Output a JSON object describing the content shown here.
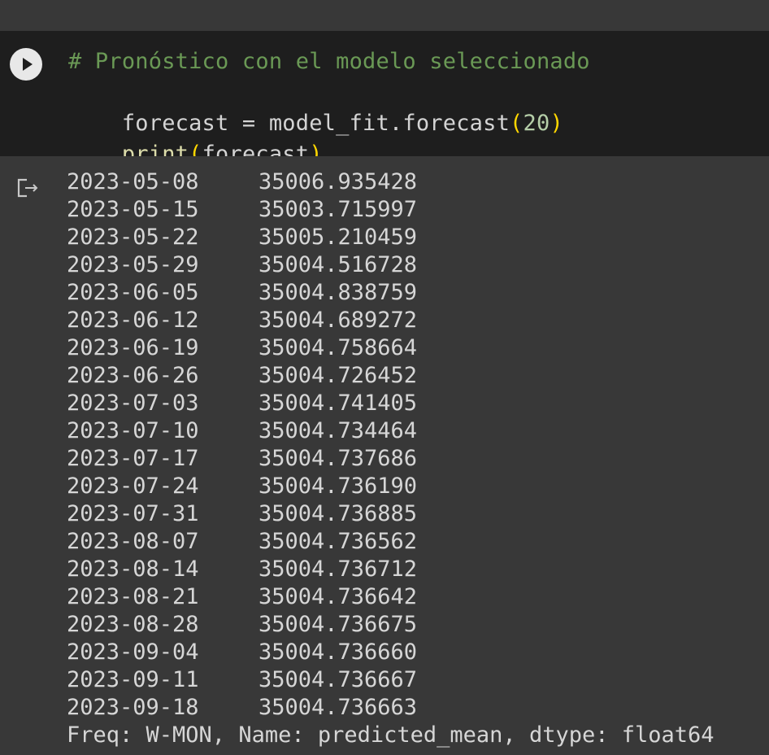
{
  "cell": {
    "comment": "# Pronóstico con el modelo seleccionado",
    "line2": {
      "lhs": "forecast = model_fit.forecast",
      "open": "(",
      "arg": "20",
      "close": ")"
    },
    "line3": {
      "func": "print",
      "open": "(",
      "arg": "forecast",
      "close": ")"
    }
  },
  "output": {
    "icon": "output-redirect-icon",
    "rows": [
      {
        "date": "2023-05-08",
        "value": "35006.935428"
      },
      {
        "date": "2023-05-15",
        "value": "35003.715997"
      },
      {
        "date": "2023-05-22",
        "value": "35005.210459"
      },
      {
        "date": "2023-05-29",
        "value": "35004.516728"
      },
      {
        "date": "2023-06-05",
        "value": "35004.838759"
      },
      {
        "date": "2023-06-12",
        "value": "35004.689272"
      },
      {
        "date": "2023-06-19",
        "value": "35004.758664"
      },
      {
        "date": "2023-06-26",
        "value": "35004.726452"
      },
      {
        "date": "2023-07-03",
        "value": "35004.741405"
      },
      {
        "date": "2023-07-10",
        "value": "35004.734464"
      },
      {
        "date": "2023-07-17",
        "value": "35004.737686"
      },
      {
        "date": "2023-07-24",
        "value": "35004.736190"
      },
      {
        "date": "2023-07-31",
        "value": "35004.736885"
      },
      {
        "date": "2023-08-07",
        "value": "35004.736562"
      },
      {
        "date": "2023-08-14",
        "value": "35004.736712"
      },
      {
        "date": "2023-08-21",
        "value": "35004.736642"
      },
      {
        "date": "2023-08-28",
        "value": "35004.736675"
      },
      {
        "date": "2023-09-04",
        "value": "35004.736660"
      },
      {
        "date": "2023-09-11",
        "value": "35004.736667"
      },
      {
        "date": "2023-09-18",
        "value": "35004.736663"
      }
    ],
    "footer": "Freq: W-MON, Name: predicted_mean, dtype: float64"
  }
}
